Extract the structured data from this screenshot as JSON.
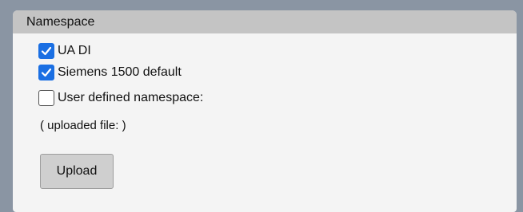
{
  "namespace_panel": {
    "title": "Namespace",
    "options": [
      {
        "label": "UA DI",
        "checked": true
      },
      {
        "label": "Siemens 1500 default",
        "checked": true
      },
      {
        "label": "User defined namespace:",
        "checked": false
      }
    ],
    "uploaded_file_text": "( uploaded file: )",
    "upload_button_label": "Upload"
  },
  "colors": {
    "background": "#8a95a3",
    "panel": "#f4f4f4",
    "header": "#c4c4c4",
    "checkbox_checked": "#1a6fe3",
    "button": "#cfcfcf"
  }
}
